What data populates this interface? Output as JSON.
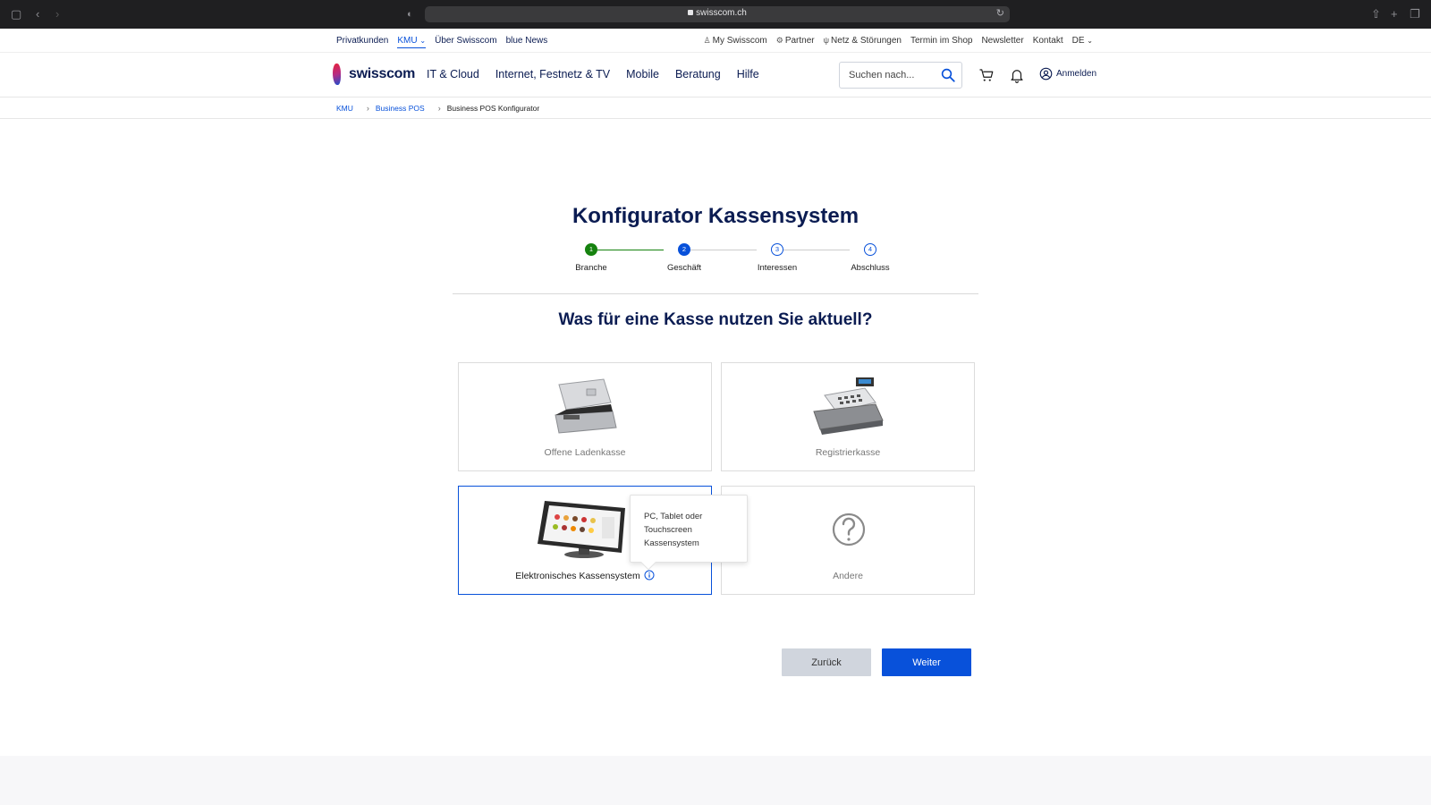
{
  "browser": {
    "url": "swisscom.ch"
  },
  "metanav": {
    "left": [
      {
        "label": "Privatkunden",
        "active": false
      },
      {
        "label": "KMU",
        "active": true
      },
      {
        "label": "Über Swisscom",
        "active": false
      },
      {
        "label": "blue News",
        "active": false
      }
    ],
    "right": {
      "my_swisscom": "My Swisscom",
      "partner": "Partner",
      "netz": "Netz & Störungen",
      "termin": "Termin im Shop",
      "newsletter": "Newsletter",
      "kontakt": "Kontakt",
      "language": "DE"
    }
  },
  "header": {
    "logo": "swisscom",
    "nav": [
      "IT & Cloud",
      "Internet, Festnetz & TV",
      "Mobile",
      "Beratung",
      "Hilfe"
    ],
    "search_placeholder": "Suchen nach...",
    "login": "Anmelden"
  },
  "breadcrumb": {
    "items": [
      "KMU",
      "Business POS",
      "Business POS Konfigurator"
    ]
  },
  "configurator": {
    "title": "Konfigurator Kassensystem",
    "steps": [
      {
        "num": "1",
        "label": "Branche",
        "state": "done"
      },
      {
        "num": "2",
        "label": "Geschäft",
        "state": "current"
      },
      {
        "num": "3",
        "label": "Interessen",
        "state": "todo"
      },
      {
        "num": "4",
        "label": "Abschluss",
        "state": "todo"
      }
    ],
    "question": "Was für eine Kasse nutzen Sie aktuell?",
    "options": [
      {
        "label": "Offene Ladenkasse",
        "selected": false
      },
      {
        "label": "Registrierkasse",
        "selected": false
      },
      {
        "label": "Elektronisches Kassensystem",
        "selected": true
      },
      {
        "label": "Andere",
        "selected": false
      }
    ],
    "tooltip": "PC, Tablet oder Touchscreen Kassensystem",
    "back_label": "Zurück",
    "next_label": "Weiter"
  },
  "colors": {
    "brand_navy": "#0b1c52",
    "primary_blue": "#0851da",
    "done_green": "#16820f"
  }
}
